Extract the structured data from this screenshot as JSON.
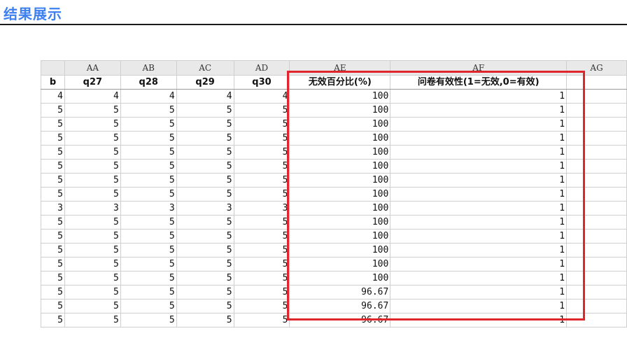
{
  "heading": "结果展示",
  "columns": [
    "",
    "AA",
    "AB",
    "AC",
    "AD",
    "AE",
    "AF",
    "AG"
  ],
  "fields": [
    "b",
    "q27",
    "q28",
    "q29",
    "q30",
    "无效百分比(%)",
    "问卷有效性(1=无效,0=有效)",
    ""
  ],
  "rows": [
    [
      "4",
      "4",
      "4",
      "4",
      "4",
      "100",
      "1"
    ],
    [
      "5",
      "5",
      "5",
      "5",
      "5",
      "100",
      "1"
    ],
    [
      "5",
      "5",
      "5",
      "5",
      "5",
      "100",
      "1"
    ],
    [
      "5",
      "5",
      "5",
      "5",
      "5",
      "100",
      "1"
    ],
    [
      "5",
      "5",
      "5",
      "5",
      "5",
      "100",
      "1"
    ],
    [
      "5",
      "5",
      "5",
      "5",
      "5",
      "100",
      "1"
    ],
    [
      "5",
      "5",
      "5",
      "5",
      "5",
      "100",
      "1"
    ],
    [
      "5",
      "5",
      "5",
      "5",
      "5",
      "100",
      "1"
    ],
    [
      "3",
      "3",
      "3",
      "3",
      "3",
      "100",
      "1"
    ],
    [
      "5",
      "5",
      "5",
      "5",
      "5",
      "100",
      "1"
    ],
    [
      "5",
      "5",
      "5",
      "5",
      "5",
      "100",
      "1"
    ],
    [
      "5",
      "5",
      "5",
      "5",
      "5",
      "100",
      "1"
    ],
    [
      "5",
      "5",
      "5",
      "5",
      "5",
      "100",
      "1"
    ],
    [
      "5",
      "5",
      "5",
      "5",
      "5",
      "100",
      "1"
    ],
    [
      "5",
      "5",
      "5",
      "5",
      "5",
      "96.67",
      "1"
    ],
    [
      "5",
      "5",
      "5",
      "5",
      "5",
      "96.67",
      "1"
    ],
    [
      "5",
      "5",
      "5",
      "5",
      "5",
      "96.67",
      "1"
    ]
  ],
  "highlight_color": "#e0252c",
  "heading_color": "#3f80f0"
}
